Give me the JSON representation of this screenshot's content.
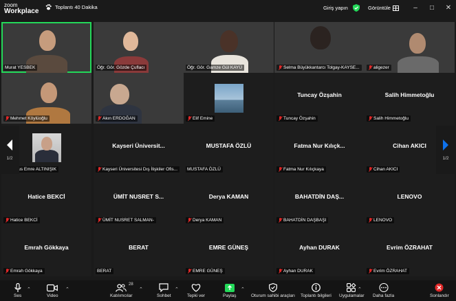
{
  "titlebar": {
    "logo_top": "zoom",
    "logo_bottom": "Workplace",
    "meeting_title": "Toplantı 40 Dakika",
    "login_label": "Giriş yapın",
    "view_label": "Görüntüle",
    "shield_color": "#23d959",
    "window_controls": [
      "minimize-icon",
      "maximize-icon",
      "close-icon"
    ]
  },
  "participants": [
    {
      "name": "Murat YESBEK",
      "muted": false,
      "video": true
    },
    {
      "name": "Öğr. Gör. Gözde Çuflacı",
      "muted": false,
      "video": true
    },
    {
      "name": "Öğr. Gör. Gamze Gül KAYÜ",
      "muted": false,
      "video": true
    },
    {
      "name": "Selma Büyükkantarcı Tolgay-KAYSE...",
      "muted": true,
      "video": true
    },
    {
      "name": "aligezer",
      "muted": true,
      "video": true
    },
    {
      "name": "Mehmet Köylüoğlu",
      "muted": true,
      "video": true
    },
    {
      "name": "Akın ERDOĞAN",
      "muted": true,
      "video": true
    },
    {
      "name": "Elif Emine",
      "muted": true,
      "video": false,
      "avatar": "photo"
    },
    {
      "name": "Tuncay Özşahin",
      "display": "Tuncay Özşahin",
      "muted": true
    },
    {
      "name": "Salih Himmetoğlu",
      "display": "Salih Himmetoğlu",
      "muted": true
    },
    {
      "name": "Yunus Emre ALTINIŞIK",
      "muted": true,
      "avatar": "photo"
    },
    {
      "name": "Kayseri Üniversitesi Dış İlişkiler Ofis...",
      "display": "Kayseri Üniversit...",
      "muted": true
    },
    {
      "name": "MUSTAFA ÖZLÜ",
      "display": "MUSTAFA ÖZLÜ",
      "muted": false
    },
    {
      "name": "Fatma Nur Kılıçkaya",
      "display": "Fatma Nur Kılıçk...",
      "muted": true
    },
    {
      "name": "Cihan AKICI",
      "display": "Cihan AKICI",
      "muted": true
    },
    {
      "name": "Hatice BEKCİ",
      "display": "Hatice BEKCİ",
      "muted": true
    },
    {
      "name": "ÜMİT NUSRET SALMAN-",
      "display": "ÜMİT NUSRET S...",
      "muted": true
    },
    {
      "name": "Derya KAMAN",
      "display": "Derya KAMAN",
      "muted": true
    },
    {
      "name": "BAHATDİN DAŞBAŞI",
      "display": "BAHATDİN DAŞ...",
      "muted": true
    },
    {
      "name": "LENOVO",
      "display": "LENOVO",
      "muted": true
    },
    {
      "name": "Emrah Gökkaya",
      "display": "Emrah Gökkaya",
      "muted": true
    },
    {
      "name": "BERAT",
      "display": "BERAT",
      "muted": false
    },
    {
      "name": "EMRE GÜNEŞ",
      "display": "EMRE GÜNEŞ",
      "muted": true
    },
    {
      "name": "Ayhan DURAK",
      "display": "Ayhan DURAK",
      "muted": true
    },
    {
      "name": "Evrim ÖZRAHAT",
      "display": "Evrim ÖZRAHAT",
      "muted": true
    }
  ],
  "pagination": {
    "left": "1/2",
    "right": "1/2",
    "right_arrow_color": "#0e72ed"
  },
  "toolbar": {
    "audio": "Ses",
    "video": "Video",
    "participants": "Katılımcılar",
    "participants_count": "28",
    "chat": "Sohbet",
    "react": "Tepki ver",
    "share": "Paylaş",
    "host_tools": "Oturum sahibi araçları",
    "meeting_info": "Toplantı bilgileri",
    "apps": "Uygulamalar",
    "more": "Daha fazla",
    "end": "Sonlandır",
    "share_color": "#23d959",
    "end_color": "#e02828"
  }
}
